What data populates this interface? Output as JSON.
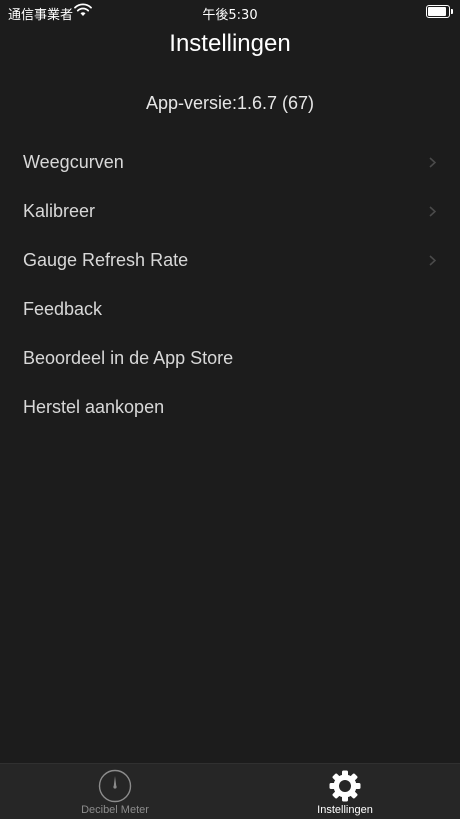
{
  "status_bar": {
    "carrier": "通信事業者",
    "time": "午後5:30",
    "battery_level": 0.8
  },
  "header": {
    "title": "Instellingen"
  },
  "app_version": "App-versie:1.6.7 (67)",
  "settings": {
    "items": [
      {
        "label": "Weegcurven",
        "chevron": true
      },
      {
        "label": "Kalibreer",
        "chevron": true
      },
      {
        "label": "Gauge Refresh Rate",
        "chevron": true
      },
      {
        "label": "Feedback",
        "chevron": false
      },
      {
        "label": "Beoordeel in de App Store",
        "chevron": false
      },
      {
        "label": "Herstel aankopen",
        "chevron": false
      }
    ]
  },
  "tab_bar": {
    "tabs": [
      {
        "label": "Decibel Meter",
        "icon": "gauge-icon",
        "selected": false
      },
      {
        "label": "Instellingen",
        "icon": "gear-icon",
        "selected": true
      }
    ]
  },
  "colors": {
    "background": "#1c1c1c",
    "tab_bar_background": "#262626",
    "selected_tab": "#ffffff",
    "unselected_tab": "#8c8c8c"
  }
}
